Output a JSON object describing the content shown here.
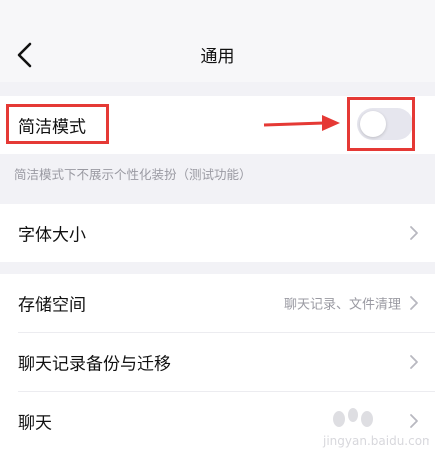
{
  "header": {
    "title": "通用"
  },
  "simple_mode": {
    "label": "简洁模式",
    "hint": "简洁模式下不展示个性化装扮（测试功能）",
    "enabled": false
  },
  "settings": [
    {
      "label": "字体大小",
      "value": ""
    },
    {
      "label": "存储空间",
      "value": "聊天记录、文件清理"
    },
    {
      "label": "聊天记录备份与迁移",
      "value": ""
    },
    {
      "label": "聊天",
      "value": ""
    }
  ],
  "colors": {
    "annotation": "#e53935",
    "toggle_off": "#e6e6ee",
    "background": "#f2f2f6"
  },
  "icons": [
    "back-arrow-icon",
    "chevron-right-icon"
  ],
  "watermark": {
    "text": "jingyan.baidu.com"
  }
}
